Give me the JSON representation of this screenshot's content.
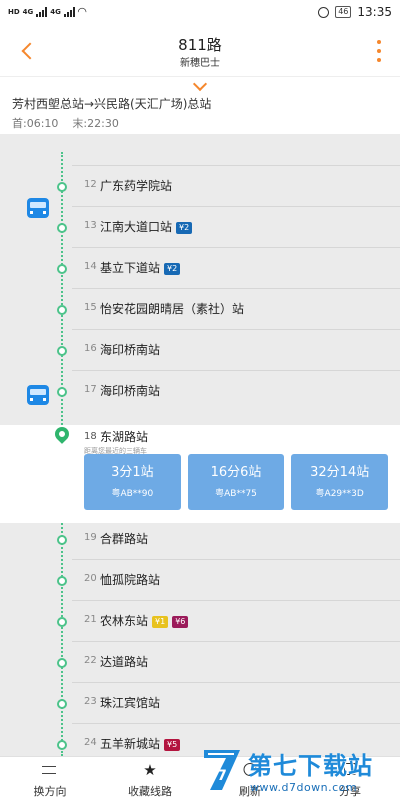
{
  "status_bar": {
    "left_labels": [
      "HD",
      "4G",
      "4G"
    ],
    "battery": "46",
    "time": "13:35"
  },
  "header": {
    "route_name": "811路",
    "company": "新穗巴士"
  },
  "info": {
    "direction": "芳村西塱总站→兴民路(天汇广场)总站",
    "first_bus": "首:06:10",
    "last_bus": "末:22:30"
  },
  "stops": [
    {
      "num": "12",
      "name": "广东药学院站"
    },
    {
      "num": "13",
      "name": "江南大道口站",
      "metro": "2",
      "metro_color": "#1769b4"
    },
    {
      "num": "14",
      "name": "基立下道站",
      "metro": "2",
      "metro_color": "#1769b4"
    },
    {
      "num": "15",
      "name": "怡安花园朗晴居（素社）站"
    },
    {
      "num": "16",
      "name": "海印桥南站"
    },
    {
      "num": "17",
      "name": "海印桥南站"
    },
    {
      "num": "19",
      "name": "合群路站"
    },
    {
      "num": "20",
      "name": "恤孤院路站"
    },
    {
      "num": "21",
      "name": "农林东站",
      "metro": "1",
      "metro_color": "#e8c21e",
      "metro2": "6",
      "metro2_color": "#9b1b5a"
    },
    {
      "num": "22",
      "name": "达道路站"
    },
    {
      "num": "23",
      "name": "珠江宾馆站"
    },
    {
      "num": "24",
      "name": "五羊新城站",
      "metro": "5",
      "metro_color": "#b3153f"
    }
  ],
  "selected_stop": {
    "num": "18",
    "name": "东湖路站",
    "hint": "距离您最近的三辆车",
    "arrivals": [
      {
        "eta": "3分1站",
        "plate": "粤AB**90"
      },
      {
        "eta": "16分6站",
        "plate": "粤AB**75"
      },
      {
        "eta": "32分14站",
        "plate": "粤A29**3D"
      }
    ]
  },
  "bottom_bar": {
    "swap": "换方向",
    "favorite": "收藏线路",
    "refresh": "刷新",
    "share": "分享"
  },
  "watermark": {
    "title": "第七下载站",
    "url": "www.d7down.com",
    "logo_glyph": "7"
  },
  "colors": {
    "accent": "#f5872d",
    "timeline": "#4cc38a",
    "card": "#6eaae5",
    "bus": "#1e88e5"
  }
}
